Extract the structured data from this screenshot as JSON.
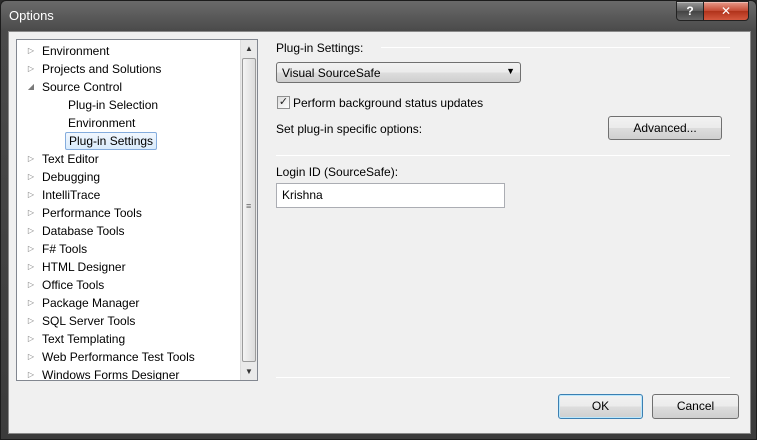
{
  "window": {
    "title": "Options",
    "help_glyph": "?",
    "close_glyph": "✕"
  },
  "tree": {
    "items": [
      {
        "label": "Environment",
        "arrow": "▷",
        "level": 0
      },
      {
        "label": "Projects and Solutions",
        "arrow": "▷",
        "level": 0
      },
      {
        "label": "Source Control",
        "arrow": "◢",
        "level": 0
      },
      {
        "label": "Plug-in Selection",
        "arrow": "",
        "level": 1
      },
      {
        "label": "Environment",
        "arrow": "",
        "level": 1
      },
      {
        "label": "Plug-in Settings",
        "arrow": "",
        "level": 1,
        "selected": true
      },
      {
        "label": "Text Editor",
        "arrow": "▷",
        "level": 0
      },
      {
        "label": "Debugging",
        "arrow": "▷",
        "level": 0
      },
      {
        "label": "IntelliTrace",
        "arrow": "▷",
        "level": 0
      },
      {
        "label": "Performance Tools",
        "arrow": "▷",
        "level": 0
      },
      {
        "label": "Database Tools",
        "arrow": "▷",
        "level": 0
      },
      {
        "label": "F# Tools",
        "arrow": "▷",
        "level": 0
      },
      {
        "label": "HTML Designer",
        "arrow": "▷",
        "level": 0
      },
      {
        "label": "Office Tools",
        "arrow": "▷",
        "level": 0
      },
      {
        "label": "Package Manager",
        "arrow": "▷",
        "level": 0
      },
      {
        "label": "SQL Server Tools",
        "arrow": "▷",
        "level": 0
      },
      {
        "label": "Text Templating",
        "arrow": "▷",
        "level": 0
      },
      {
        "label": "Web Performance Test Tools",
        "arrow": "▷",
        "level": 0
      },
      {
        "label": "Windows Forms Designer",
        "arrow": "▷",
        "level": 0
      }
    ],
    "scroll_up_glyph": "▲",
    "scroll_down_glyph": "▼",
    "grip_glyph": "≡"
  },
  "settings": {
    "section_label": "Plug-in Settings:",
    "plugin_dropdown_value": "Visual SourceSafe",
    "dropdown_arrow_glyph": "▼",
    "checkbox_label": "Perform background status updates",
    "checkbox_checked": true,
    "checkbox_glyph": "✓",
    "specific_options_label": "Set plug-in specific options:",
    "advanced_button": "Advanced...",
    "login_label": "Login ID (SourceSafe):",
    "login_value": "Krishna"
  },
  "footer": {
    "ok_button": "OK",
    "cancel_button": "Cancel"
  },
  "colors": {
    "selection_border": "#84acdd",
    "close_red": "#c44a33"
  }
}
